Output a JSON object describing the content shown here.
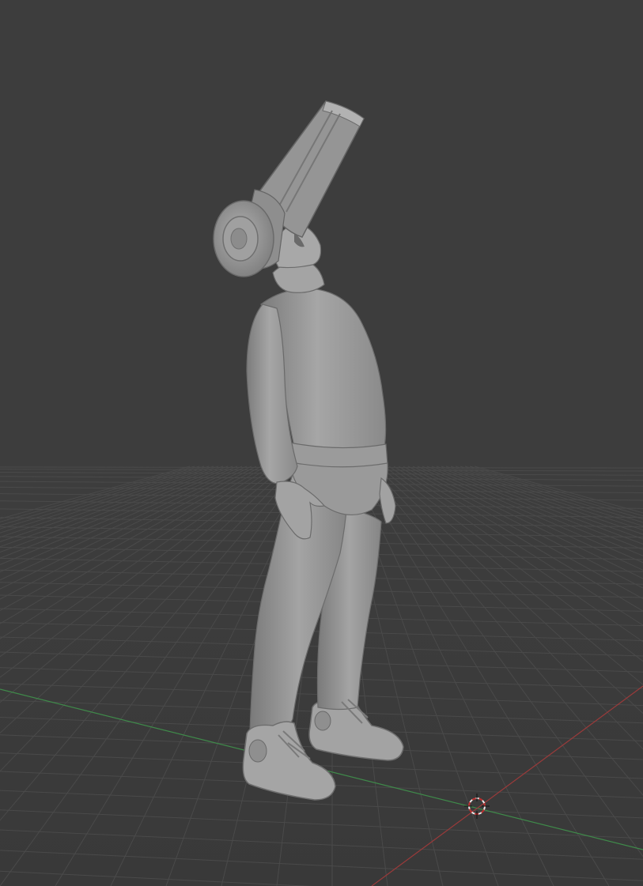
{
  "viewport": {
    "background_color": "#3d3d3d",
    "grid_color": "#4a4a4a",
    "x_axis_color": "#9a3a3a",
    "y_axis_color": "#3f8a4a",
    "model_color": "#9c9c9c",
    "model_shadow_color": "#6f6f6f",
    "model_highlight_color": "#b5b5b5"
  },
  "scene": {
    "object": "sculpted-figure-mesh",
    "cursor_icon": "3d-cursor-icon"
  }
}
